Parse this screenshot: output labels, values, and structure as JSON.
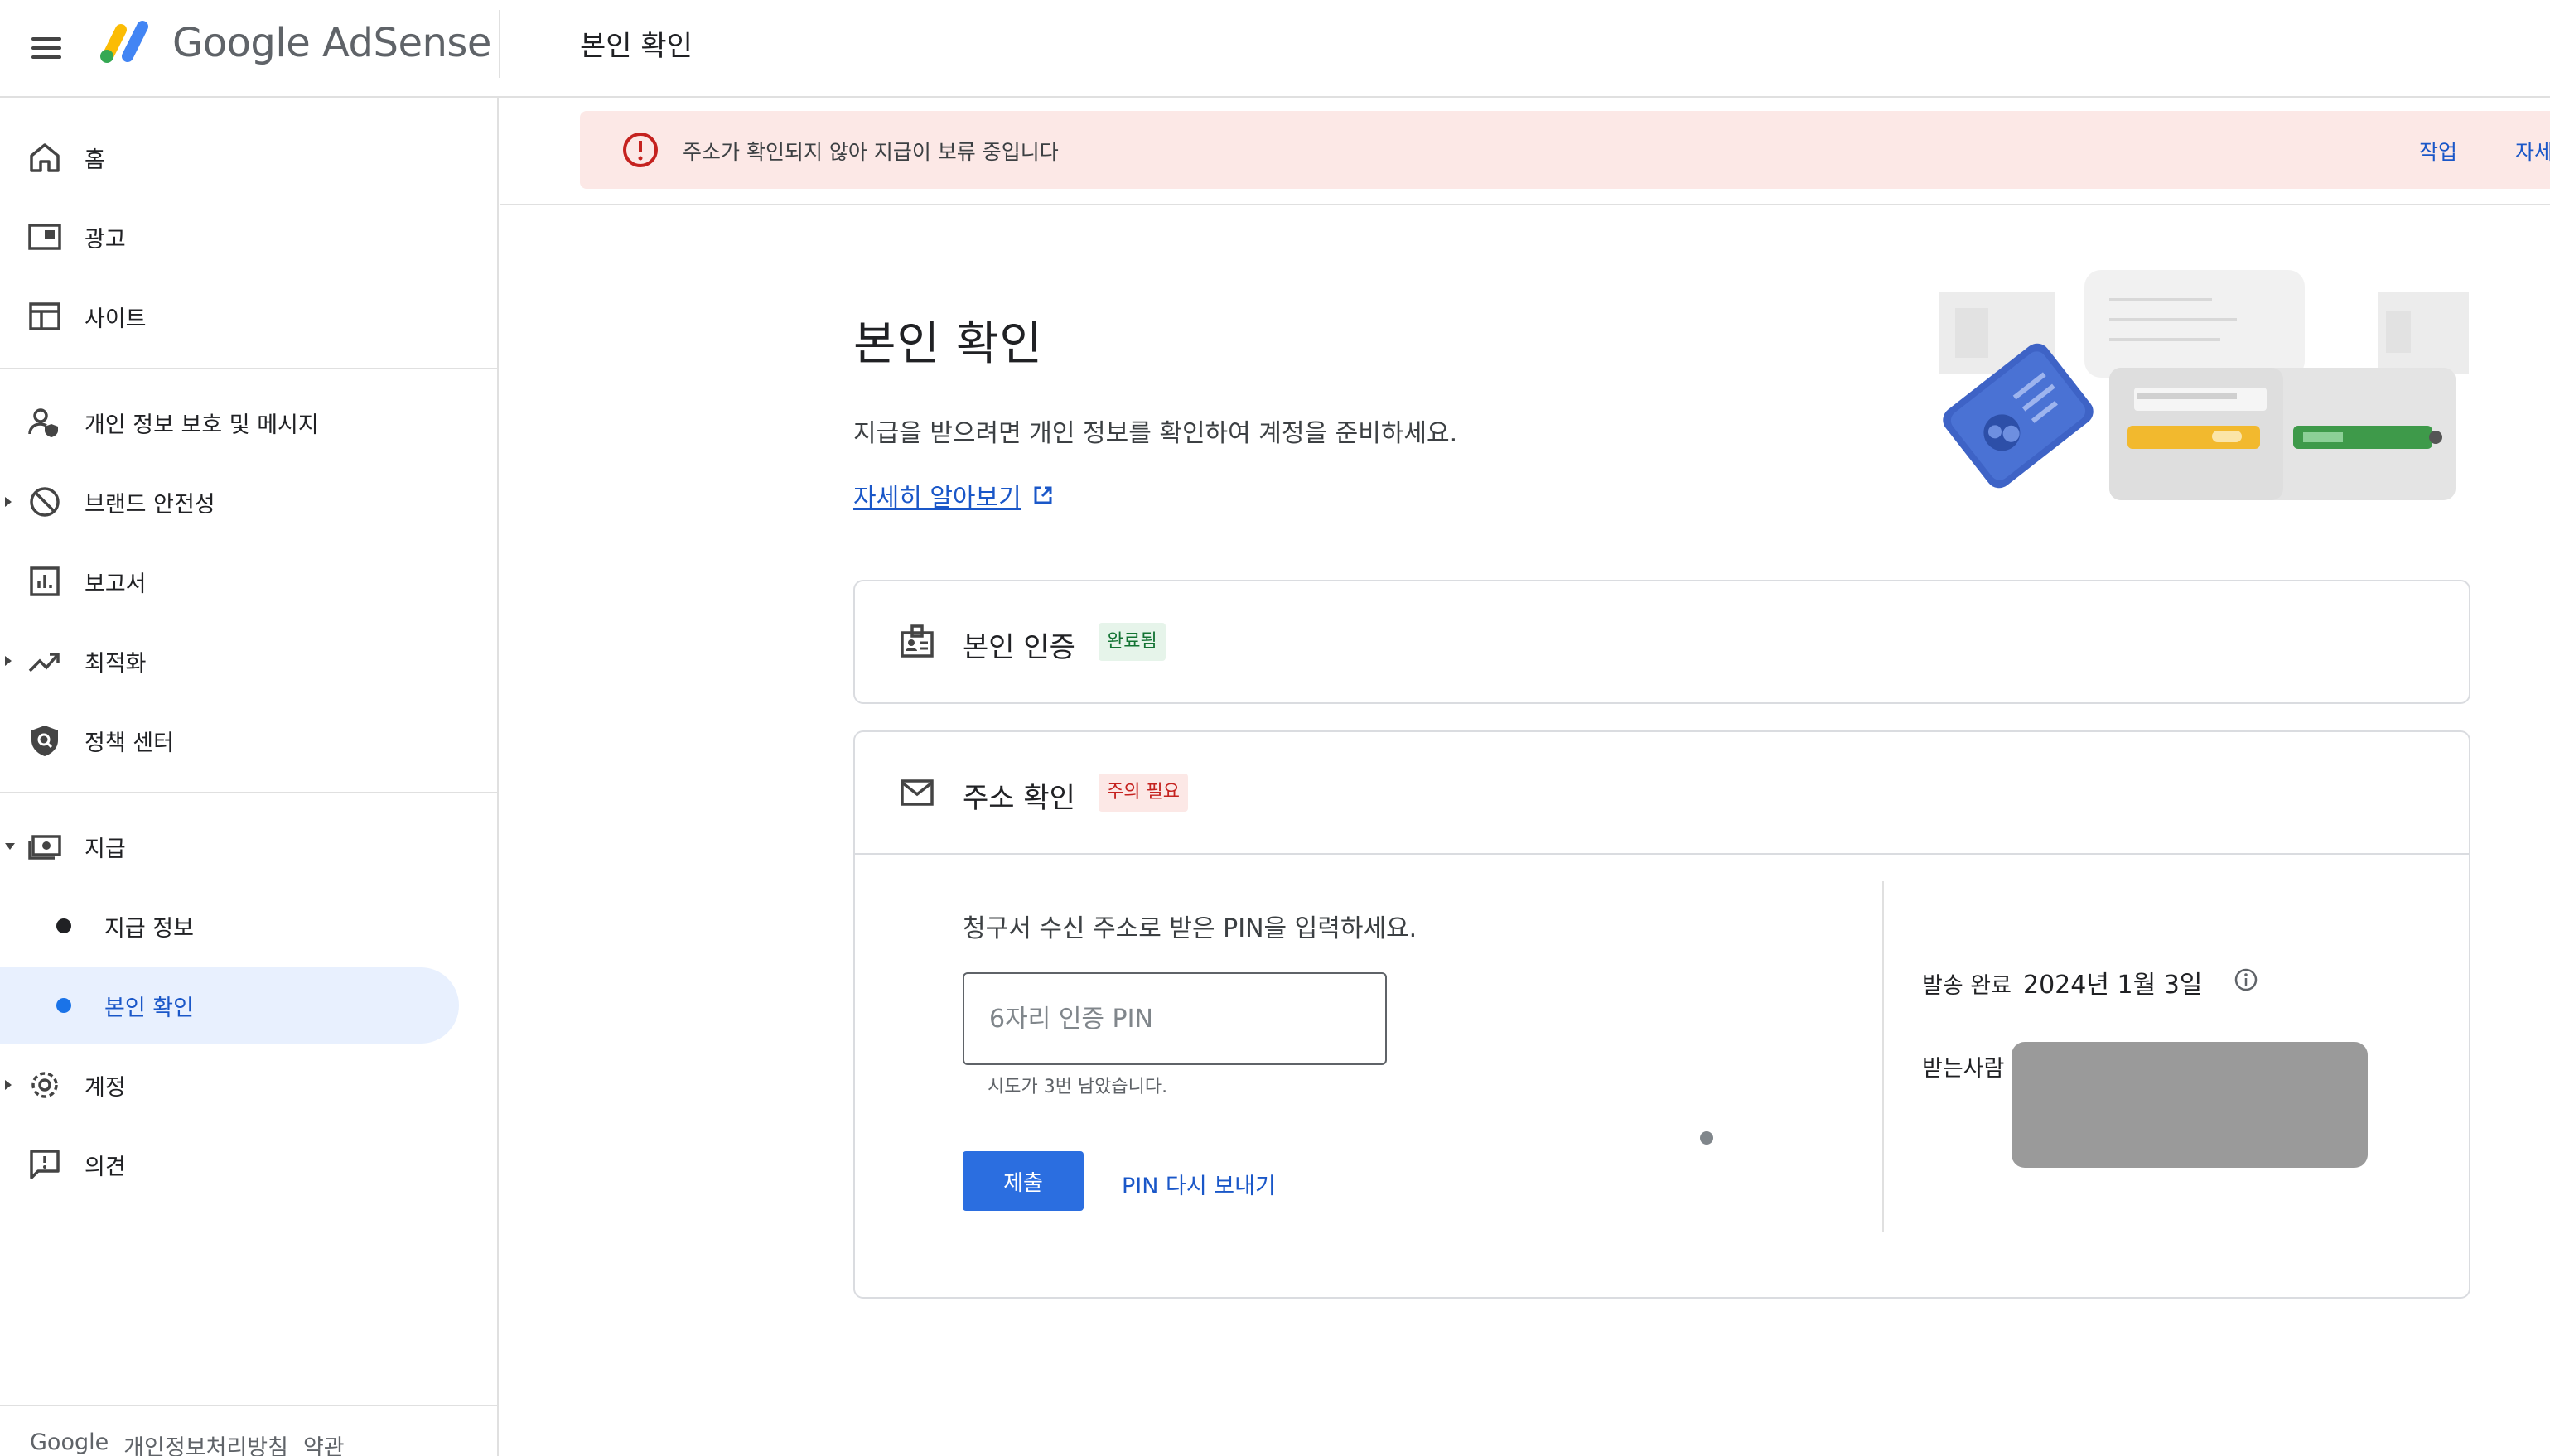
{
  "app": {
    "brand": "Google AdSense",
    "page_heading": "본인 확인"
  },
  "sidebar": {
    "items": [
      {
        "label": "홈",
        "icon": "home-icon"
      },
      {
        "label": "광고",
        "icon": "ads-icon"
      },
      {
        "label": "사이트",
        "icon": "sites-icon"
      },
      {
        "label": "개인 정보 보호 및 메시지",
        "icon": "privacy-icon"
      },
      {
        "label": "브랜드 안전성",
        "icon": "block-icon"
      },
      {
        "label": "보고서",
        "icon": "reports-icon"
      },
      {
        "label": "최적화",
        "icon": "trending-icon"
      },
      {
        "label": "정책 센터",
        "icon": "shield-icon"
      },
      {
        "label": "지급",
        "icon": "payments-icon"
      },
      {
        "label": "지급 정보"
      },
      {
        "label": "본인 확인"
      },
      {
        "label": "계정",
        "icon": "gear-icon"
      },
      {
        "label": "의견",
        "icon": "feedback-icon"
      }
    ],
    "footer": {
      "google": "Google",
      "privacy": "개인정보처리방침",
      "terms": "약관"
    }
  },
  "alert": {
    "text": "주소가 확인되지 않아 지급이 보류 중입니다",
    "action": "작업",
    "details": "자세"
  },
  "main": {
    "title": "본인 확인",
    "description": "지급을 받으려면 개인 정보를 확인하여 계정을 준비하세요.",
    "learn_more": "자세히 알아보기"
  },
  "identity_card": {
    "title": "본인 인증",
    "badge": "완료됨"
  },
  "address_card": {
    "title": "주소 확인",
    "badge": "주의 필요",
    "instruction": "청구서 수신 주소로 받은 PIN을 입력하세요.",
    "pin_placeholder": "6자리 인증 PIN",
    "attempts": "시도가 3번 남았습니다.",
    "submit": "제출",
    "resend": "PIN 다시 보내기",
    "sent_label": "발송 완료",
    "sent_date": "2024년 1월 3일",
    "recipient_label": "받는사람"
  },
  "colors": {
    "accent": "#1a73e8",
    "alert_bg": "#fce8e6",
    "success": "#137333",
    "danger": "#c5221f"
  }
}
